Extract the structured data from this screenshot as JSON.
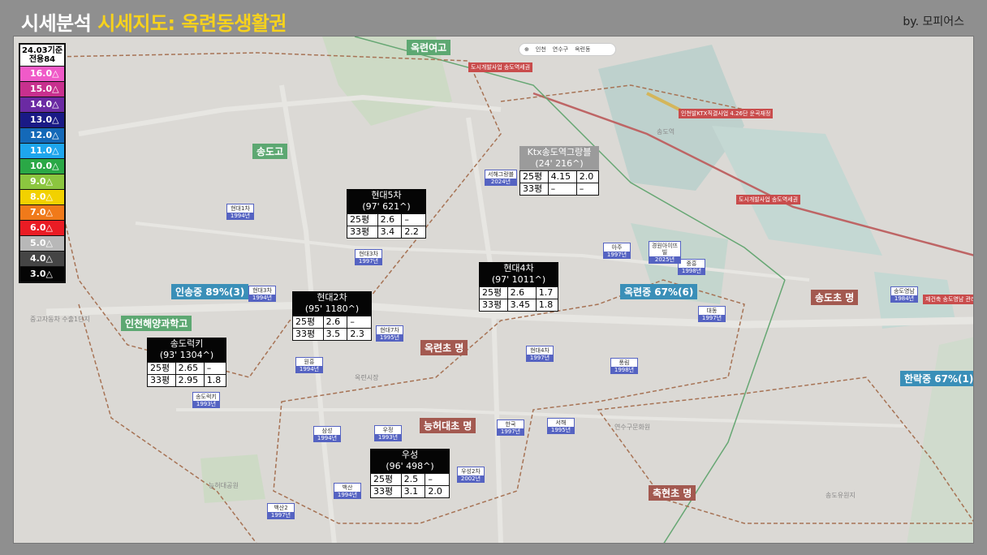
{
  "header": {
    "title_prefix": "시세분석",
    "title_highlight": "시세지도: 옥련동생활권",
    "byline": "by. 모피어스"
  },
  "legend": {
    "line1": "24.03기준",
    "line2": "전용84",
    "steps": [
      {
        "label": "16.0△",
        "color": "#f05ac8"
      },
      {
        "label": "15.0△",
        "color": "#c8308e"
      },
      {
        "label": "14.0△",
        "color": "#6b2aa3"
      },
      {
        "label": "13.0△",
        "color": "#1a1a86"
      },
      {
        "label": "12.0△",
        "color": "#1469b8"
      },
      {
        "label": "11.0△",
        "color": "#1ea6ee"
      },
      {
        "label": "10.0△",
        "color": "#2aa846"
      },
      {
        "label": "9.0△",
        "color": "#8cc63f"
      },
      {
        "label": "8.0△",
        "color": "#f2d100"
      },
      {
        "label": "7.0△",
        "color": "#f07a1a"
      },
      {
        "label": "6.0△",
        "color": "#ea1c24"
      },
      {
        "label": "5.0△",
        "color": "#b8b8b8"
      },
      {
        "label": "4.0△",
        "color": "#454545"
      },
      {
        "label": "3.0△",
        "color": "#050505"
      }
    ]
  },
  "map_controls": {
    "a": "인천",
    "b": "연수구",
    "c": "옥련동"
  },
  "price_boxes": [
    {
      "id": "ktx",
      "title1": "Ktx송도역그랑블",
      "title2": "(24' 216^)",
      "rows": [
        [
          "25평",
          "4.15",
          "2.0"
        ],
        [
          "33평",
          "–",
          "–"
        ]
      ]
    },
    {
      "id": "h5",
      "title1": "현대5차",
      "title2": "(97' 621^)",
      "rows": [
        [
          "25평",
          "2.6",
          "–"
        ],
        [
          "33평",
          "3.4",
          "2.2"
        ]
      ]
    },
    {
      "id": "h4",
      "title1": "현대4차",
      "title2": "(97' 1011^)",
      "rows": [
        [
          "25평",
          "2.6",
          "1.7"
        ],
        [
          "33평",
          "3.45",
          "1.8"
        ]
      ]
    },
    {
      "id": "h2",
      "title1": "현대2차",
      "title2": "(95' 1180^)",
      "rows": [
        [
          "25평",
          "2.6",
          "–"
        ],
        [
          "33평",
          "3.5",
          "2.3"
        ]
      ]
    },
    {
      "id": "srk",
      "title1": "송도럭키",
      "title2": "(93' 1304^)",
      "rows": [
        [
          "25평",
          "2.65",
          "–"
        ],
        [
          "33평",
          "2.95",
          "1.8"
        ]
      ]
    },
    {
      "id": "us",
      "title1": "우성",
      "title2": "(96' 498^)",
      "rows": [
        [
          "25평",
          "2.5",
          "–"
        ],
        [
          "33평",
          "3.1",
          "2.0"
        ]
      ]
    }
  ],
  "schools": [
    {
      "label": "옥련여고",
      "style": "grn"
    },
    {
      "label": "송도고",
      "style": "grn"
    },
    {
      "label": "인송중 89%(3)",
      "style": "blu"
    },
    {
      "label": "인천해양과학고",
      "style": "grn"
    },
    {
      "label": "옥련중 67%(6)",
      "style": "blu"
    },
    {
      "label": "옥련초 명",
      "style": "red"
    },
    {
      "label": "능허대초 명",
      "style": "red"
    },
    {
      "label": "송도초 명",
      "style": "red"
    },
    {
      "label": "한락중 67%(1)",
      "style": "blu"
    },
    {
      "label": "축현초 명",
      "style": "red"
    }
  ],
  "apt_markers": [
    {
      "name": "현대1차",
      "year": "1994년"
    },
    {
      "name": "현대3차",
      "year": "1997년"
    },
    {
      "name": "현대3차",
      "year": "1994년"
    },
    {
      "name": "현대7차",
      "year": "1995년"
    },
    {
      "name": "현대4차",
      "year": "1997년"
    },
    {
      "name": "원흥",
      "year": "1994년"
    },
    {
      "name": "송도럭키",
      "year": "1993년"
    },
    {
      "name": "삼성",
      "year": "1994년"
    },
    {
      "name": "우정",
      "year": "1993년"
    },
    {
      "name": "한국",
      "year": "1997년"
    },
    {
      "name": "서해",
      "year": "1995년"
    },
    {
      "name": "백산",
      "year": "1994년"
    },
    {
      "name": "백산2",
      "year": "1997년"
    },
    {
      "name": "우성2차",
      "year": "2002년"
    },
    {
      "name": "아주",
      "year": "1997년"
    },
    {
      "name": "중흥",
      "year": "1998년"
    },
    {
      "name": "대동",
      "year": "1997년"
    },
    {
      "name": "풍림",
      "year": "1998년"
    },
    {
      "name": "송도영남",
      "year": "1984년"
    },
    {
      "name": "서해그랑블",
      "year": "2024년"
    },
    {
      "name": "경원아이뜨빌",
      "year": "2025년"
    }
  ],
  "map_labels": [
    "옥련시장",
    "송도역",
    "중고자동차 수출1단지",
    "능허대공원",
    "연수구문화원",
    "송도유원지"
  ],
  "red_tags": [
    "도시개발사업 송도역세권",
    "인천발KTX직결사업 4.26단 운곡재정",
    "도시개발사업 송도역세권",
    "재건축 송도영남 관리처분 승가"
  ]
}
